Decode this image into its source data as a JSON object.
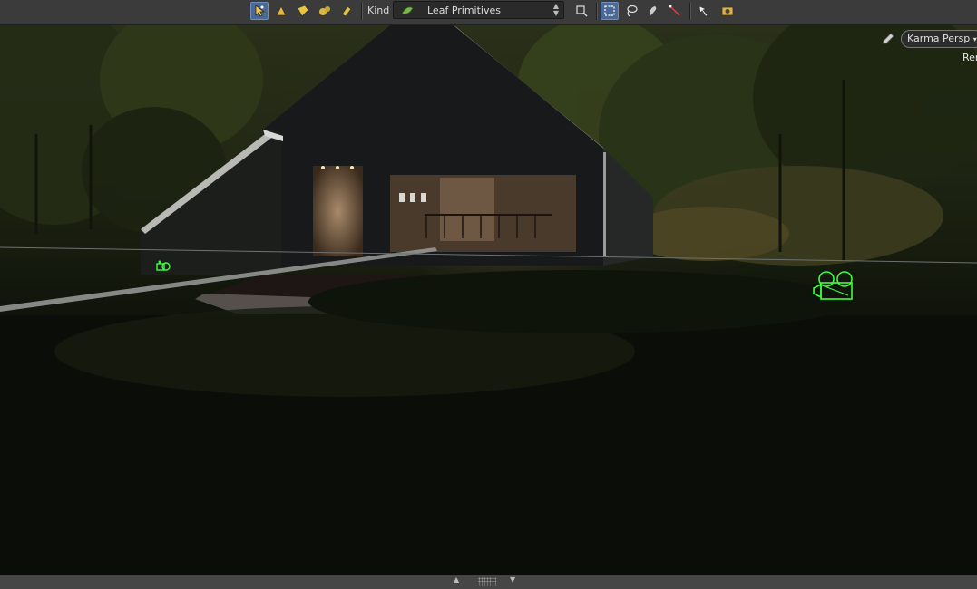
{
  "toolbar": {
    "kind_label": "Kind",
    "kind_value": "Leaf Primitives",
    "icons": [
      "select-arrow-icon",
      "select-points-icon",
      "select-edges-icon",
      "select-group-icon",
      "select-paint-icon",
      "transform-icon",
      "box-select-icon",
      "lasso-select-icon",
      "brush-select-icon",
      "laser-select-icon",
      "pick-icon",
      "snapshot-icon"
    ]
  },
  "viewport": {
    "camera_menu": "Karma Persp",
    "render_label": "Ren"
  },
  "colors": {
    "active_tool": "#4a6a94",
    "light_gizmo": "#3cff3c",
    "toolbar_bg": "#3b3b3b"
  }
}
